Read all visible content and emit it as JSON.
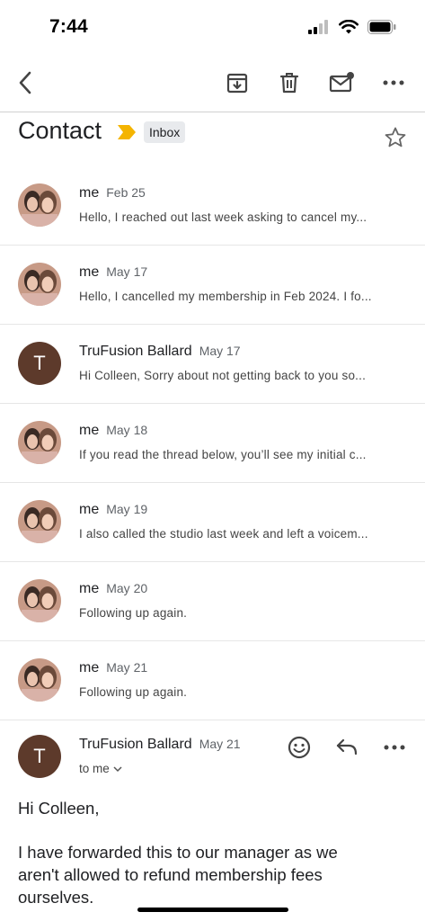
{
  "status": {
    "time": "7:44"
  },
  "toolbar": {
    "back_icon": "back-arrow-icon",
    "archive_icon": "archive-icon",
    "delete_icon": "trash-icon",
    "unread_icon": "mark-unread-icon",
    "more_icon": "more-horizontal-icon"
  },
  "subject": {
    "title": "Contact",
    "label": "Inbox",
    "importance_color": "#f4b400"
  },
  "messages": [
    {
      "sender": "me",
      "date": "Feb 25",
      "snippet": "Hello, I reached out last week asking to cancel my...",
      "avatar": "photo"
    },
    {
      "sender": "me",
      "date": "May 17",
      "snippet": "Hello, I cancelled my membership in Feb 2024. I fo...",
      "avatar": "photo"
    },
    {
      "sender": "TruFusion Ballard",
      "date": "May 17",
      "snippet": "Hi Colleen, Sorry about not getting back to you so...",
      "avatar": "T"
    },
    {
      "sender": "me",
      "date": "May 18",
      "snippet": "If you read the thread below, you’ll see my initial c...",
      "avatar": "photo"
    },
    {
      "sender": "me",
      "date": "May 19",
      "snippet": "I also called the studio last week and left a voicem...",
      "avatar": "photo"
    },
    {
      "sender": "me",
      "date": "May 20",
      "snippet": "Following up again.",
      "avatar": "photo"
    },
    {
      "sender": "me",
      "date": "May 21",
      "snippet": "Following up again.",
      "avatar": "photo"
    }
  ],
  "expanded": {
    "avatar": "T",
    "sender": "TruFusion Ballard",
    "date": "May 21",
    "to": "to me",
    "greeting": "Hi Colleen,",
    "body_line1": "I have forwarded this to our manager as we",
    "body_line2": "aren't allowed to refund membership fees",
    "body_line3": "ourselves."
  },
  "colors": {
    "avatar_bg": "#5d3a2b",
    "divider": "#e6e6e6"
  }
}
